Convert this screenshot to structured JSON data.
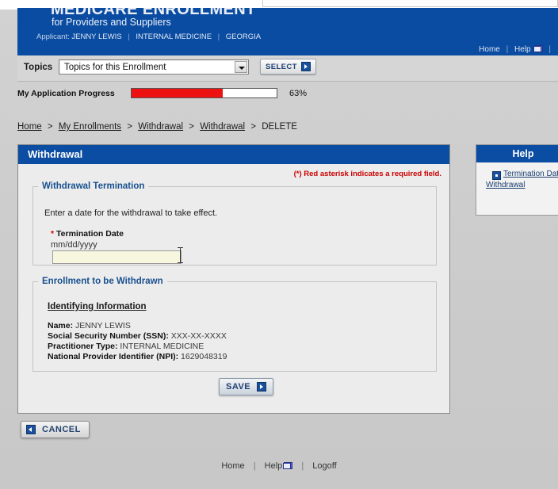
{
  "banner": {
    "title": "MEDICARE ENROLLMENT",
    "subtitle": "for Providers and Suppliers",
    "applicant_label": "Applicant:",
    "applicant_name": "JENNY LEWIS",
    "applicant_specialty": "INTERNAL MEDICINE",
    "applicant_state": "GEORGIA",
    "home_link": "Home",
    "help_link": "Help",
    "separator": "|"
  },
  "topics": {
    "label": "Topics",
    "selected": "Topics for this Enrollment",
    "select_button": "SELECT"
  },
  "progress": {
    "label": "My Application Progress",
    "percent_text": "63%",
    "percent_value": 63,
    "fill_color": "#ee1111"
  },
  "breadcrumb": {
    "items": [
      {
        "label": "Home",
        "link": true
      },
      {
        "label": "My Enrollments",
        "link": true
      },
      {
        "label": "Withdrawal",
        "link": true
      },
      {
        "label": "Withdrawal",
        "link": true
      },
      {
        "label": "DELETE",
        "link": false
      }
    ],
    "separator": ">"
  },
  "panel": {
    "title": "Withdrawal",
    "required_note": "(*) Red asterisk indicates a required field.",
    "termination_group": {
      "legend": "Withdrawal Termination",
      "instruction": "Enter a date for the withdrawal to take effect.",
      "asterisk": "*",
      "field_label": "Termination Date",
      "field_hint": "mm/dd/yyyy",
      "field_value": ""
    },
    "enrollment_group": {
      "legend": "Enrollment to be Withdrawn",
      "subheading": "Identifying Information",
      "rows": [
        {
          "key": "Name:",
          "value": "JENNY  LEWIS"
        },
        {
          "key": "Social Security Number (SSN):",
          "value": "XXX-XX-XXXX"
        },
        {
          "key": "Practitioner Type:",
          "value": "INTERNAL MEDICINE"
        },
        {
          "key": "National Provider Identifier (NPI):",
          "value": "1629048319"
        }
      ]
    },
    "save_button": "SAVE"
  },
  "cancel_button": "CANCEL",
  "help_panel": {
    "title": "Help",
    "link_line1": "Termination Dat",
    "link_line2": "Withdrawal"
  },
  "footer": {
    "home": "Home",
    "help": "Help",
    "logoff": "Logoff",
    "separator": "|"
  }
}
